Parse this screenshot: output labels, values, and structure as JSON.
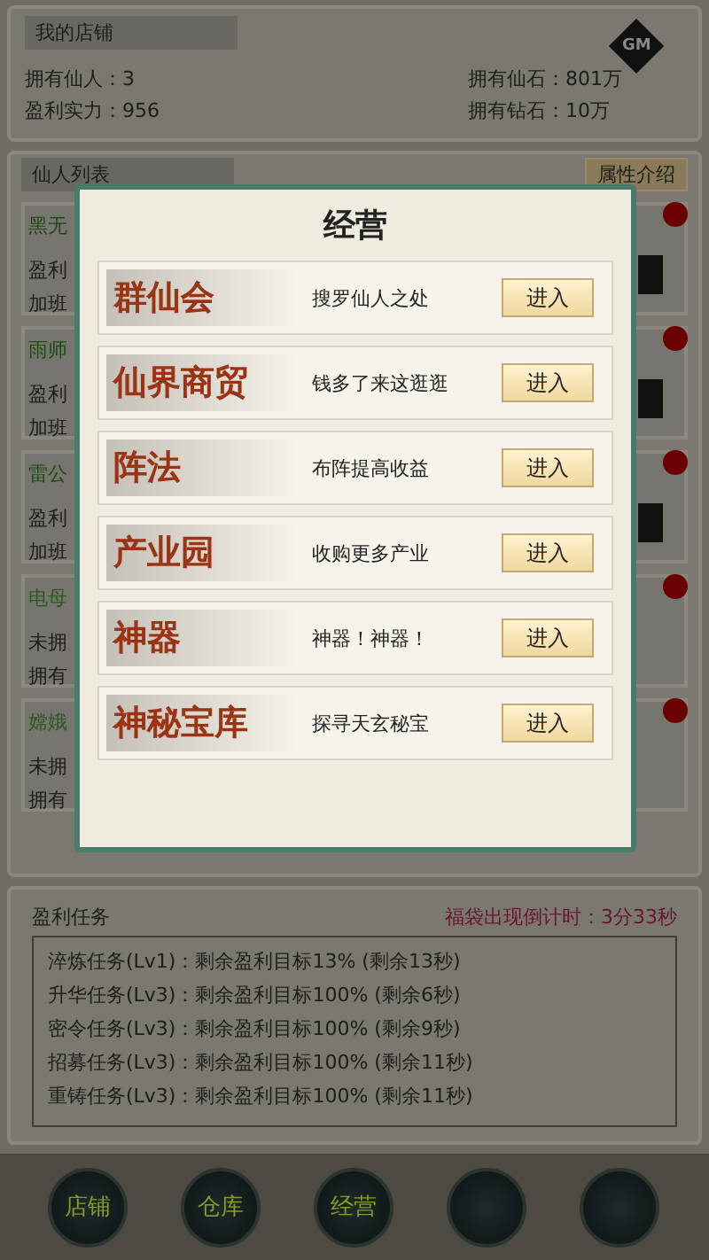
{
  "shop": {
    "title": "我的店铺",
    "stats": [
      {
        "label": "拥有仙人：3"
      },
      {
        "label": "拥有仙石：801万"
      },
      {
        "label": "盈利实力：956"
      },
      {
        "label": "拥有钻石：10万"
      }
    ],
    "gm_badge": "GM"
  },
  "immortal_list": {
    "title": "仙人列表",
    "info_button": "属性介绍",
    "cards": [
      {
        "name": "黑无",
        "lines": [
          "盈利",
          "加班"
        ],
        "owned": true
      },
      {
        "name": "雨师",
        "lines": [
          "盈利",
          "加班"
        ],
        "owned": true
      },
      {
        "name": "雷公",
        "lines": [
          "盈利",
          "加班"
        ],
        "owned": true
      },
      {
        "name": "电母",
        "lines": [
          "未拥",
          "拥有"
        ],
        "owned": false
      },
      {
        "name": "嫦娥",
        "lines": [
          "未拥",
          "拥有"
        ],
        "owned": false
      }
    ]
  },
  "tasks": {
    "title": "盈利任务",
    "countdown": "福袋出现倒计时：3分33秒",
    "items": [
      "淬炼任务(Lv1)：剩余盈利目标13% (剩余13秒)",
      "升华任务(Lv3)：剩余盈利目标100% (剩余6秒)",
      "密令任务(Lv3)：剩余盈利目标100% (剩余9秒)",
      "招募任务(Lv3)：剩余盈利目标100% (剩余11秒)",
      "重铸任务(Lv3)：剩余盈利目标100% (剩余11秒)"
    ]
  },
  "nav": [
    {
      "kind": "label",
      "label": "店铺"
    },
    {
      "kind": "label",
      "label": "仓库"
    },
    {
      "kind": "label",
      "label": "经营"
    },
    {
      "kind": "blank"
    },
    {
      "kind": "blank"
    }
  ],
  "dialog": {
    "title": "经营",
    "rows": [
      {
        "name": "群仙会",
        "description": "搜罗仙人之处",
        "button": "进入"
      },
      {
        "name": "仙界商贸",
        "description": "钱多了来这逛逛",
        "button": "进入"
      },
      {
        "name": "阵法",
        "description": "布阵提高收益",
        "button": "进入"
      },
      {
        "name": "产业园",
        "description": "收购更多产业",
        "button": "进入"
      },
      {
        "name": "神器",
        "description": "神器！神器！",
        "button": "进入"
      },
      {
        "name": "神秘宝库",
        "description": "探寻天玄秘宝",
        "button": "进入"
      }
    ]
  }
}
